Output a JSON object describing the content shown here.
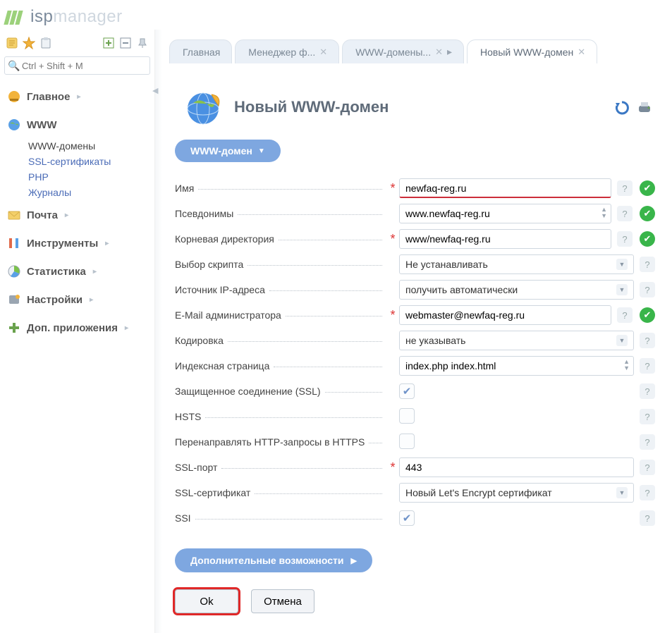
{
  "brand": {
    "part1": "isp",
    "part2": "manager"
  },
  "search": {
    "placeholder": "Ctrl + Shift + M"
  },
  "sidebar": {
    "home": "Главное",
    "www": "WWW",
    "www_items": {
      "domains": "WWW-домены",
      "ssl": "SSL-сертификаты",
      "php": "PHP",
      "logs": "Журналы"
    },
    "mail": "Почта",
    "tools": "Инструменты",
    "stats": "Статистика",
    "settings": "Настройки",
    "addons": "Доп. приложения"
  },
  "tabs": {
    "t0": "Главная",
    "t1": "Менеджер ф...",
    "t2": "WWW-домены...",
    "t3": "Новый WWW-домен"
  },
  "page": {
    "title": "Новый WWW-домен",
    "section": "WWW-домен",
    "more": "Дополнительные возможности"
  },
  "labels": {
    "name": "Имя",
    "aliases": "Псевдонимы",
    "root": "Корневая директория",
    "script": "Выбор скрипта",
    "ipsrc": "Источник IP-адреса",
    "email": "E-Mail администратора",
    "enc": "Кодировка",
    "index": "Индексная страница",
    "ssl": "Защищенное соединение (SSL)",
    "hsts": "HSTS",
    "redirect": "Перенаправлять HTTP-запросы в HTTPS",
    "sslport": "SSL-порт",
    "sslcert": "SSL-сертификат",
    "ssi": "SSI"
  },
  "values": {
    "name": "newfaq-reg.ru",
    "aliases": "www.newfaq-reg.ru",
    "root": "www/newfaq-reg.ru",
    "script": "Не устанавливать",
    "ipsrc": "получить автоматически",
    "email": "webmaster@newfaq-reg.ru",
    "enc": "не указывать",
    "index": "index.php index.html",
    "sslport": "443",
    "sslcert": "Новый Let's Encrypt сертификат"
  },
  "buttons": {
    "ok": "Ok",
    "cancel": "Отмена"
  }
}
